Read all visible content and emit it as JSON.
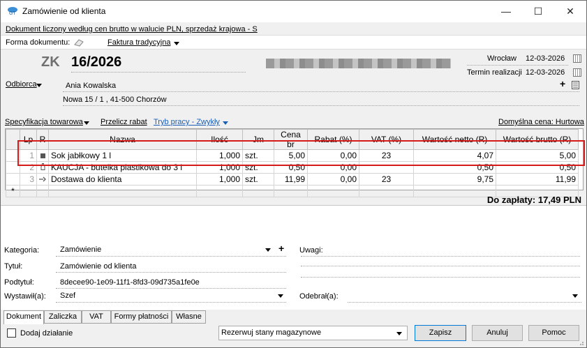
{
  "window": {
    "title": "Zamówienie od klienta",
    "controls": {
      "minimize": "—",
      "maximize": "☐",
      "close": "✕"
    }
  },
  "info_bar": "Dokument liczony według cen brutto w walucie PLN, sprzedaż krajowa - S",
  "forma": {
    "label": "Forma dokumentu:",
    "value": "Faktura tradycyjna"
  },
  "document": {
    "prefix": "ZK",
    "number": "16/2026"
  },
  "header_right": {
    "place": "Wrocław",
    "date": "12-03-2026",
    "termin_label": "Termin realizacji",
    "termin_date": "12-03-2026"
  },
  "odbiorca": {
    "label": "Odbiorca",
    "name": "Ania Kowalska",
    "address": "Nowa 15 / 1 , 41-500 Chorzów"
  },
  "toolbar": {
    "spec": "Specyfikacja towarowa",
    "przelicz": "Przelicz rabat",
    "tryb": "Tryb pracy - Zwykły",
    "domyslna": "Domyślna cena: Hurtowa"
  },
  "table": {
    "headers": [
      "Lp",
      "R",
      "Nazwa",
      "Ilość",
      "Jm",
      "Cena br",
      "Rabat (%)",
      "VAT (%)",
      "Wartość netto (R)",
      "Wartość brutto (R)"
    ],
    "rows": [
      {
        "lp": "1",
        "r_icon": "product-icon",
        "nazwa": "Sok jabłkowy 1 l",
        "ilosc": "1,000",
        "jm": "szt.",
        "cena": "5,00",
        "rabat": "0,00",
        "vat": "23",
        "netto": "4,07",
        "brutto": "5,00"
      },
      {
        "lp": "2",
        "r_icon": "bottle-icon",
        "nazwa": "KAUCJA - butelka plastikowa do 3 l",
        "ilosc": "1,000",
        "jm": "szt.",
        "cena": "0,50",
        "rabat": "0,00",
        "vat": "",
        "netto": "0,50",
        "brutto": "0,50"
      },
      {
        "lp": "3",
        "r_icon": "service-icon",
        "nazwa": "Dostawa do klienta",
        "ilosc": "1,000",
        "jm": "szt.",
        "cena": "11,99",
        "rabat": "0,00",
        "vat": "23",
        "netto": "9,75",
        "brutto": "11,99"
      }
    ],
    "new_row_marker": "*"
  },
  "total": "Do zapłaty: 17,49 PLN",
  "fields": {
    "kategoria_label": "Kategoria:",
    "kategoria": "Zamówienie",
    "tytul_label": "Tytuł:",
    "tytul": "Zamówienie od klienta",
    "podtytul_label": "Podtytuł:",
    "podtytul": "8decee90-1e09-11f1-8fd3-09d735a1fe0e",
    "wystawil_label": "Wystawił(a):",
    "wystawil": "Szef",
    "uwagi_label": "Uwagi:",
    "odebral_label": "Odebrał(a):"
  },
  "tabs": [
    "Dokument",
    "Zaliczka",
    "VAT",
    "Formy płatności",
    "Własne"
  ],
  "footer": {
    "dodaj": "Dodaj działanie",
    "rezerwuj": "Rezerwuj stany magazynowe",
    "zapisz": "Zapisz",
    "anuluj": "Anuluj",
    "pomoc": "Pomoc"
  },
  "colors": {
    "highlight_border": "#d51a1a",
    "link": "#1a5fb4"
  }
}
